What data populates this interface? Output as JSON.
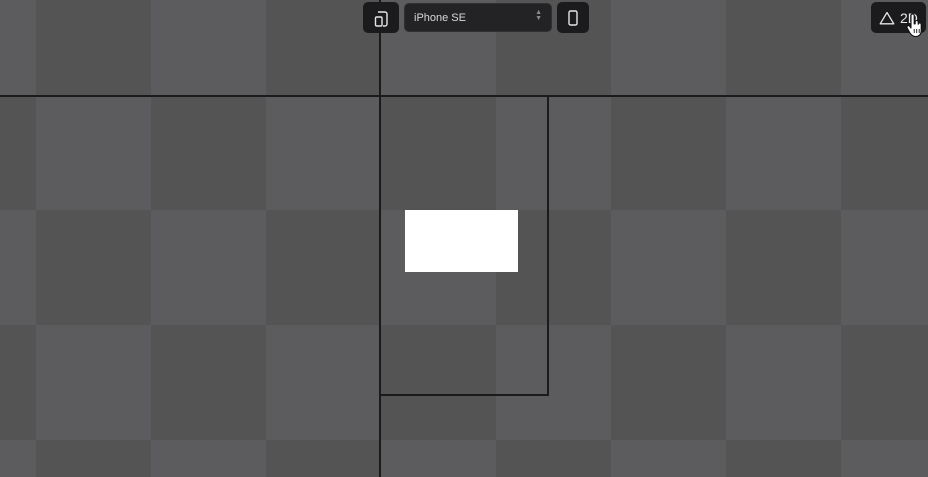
{
  "toolbar": {
    "device_select": {
      "value": "iPhone SE"
    },
    "mode_toggle": {
      "label": "2D"
    }
  },
  "icons": {
    "rotate": "rotate-device-icon",
    "orientation": "portrait-phone-icon",
    "mode": "triangle-icon",
    "caret": "updown-caret-icon",
    "cursor": "hand-pointer-icon"
  },
  "colors": {
    "canvas_light": "#5c5b5e",
    "canvas_dark": "#545454",
    "toolbar_bg": "#1b1b1d",
    "guide_line": "#1b1b1d",
    "content_block": "#ffffff"
  }
}
